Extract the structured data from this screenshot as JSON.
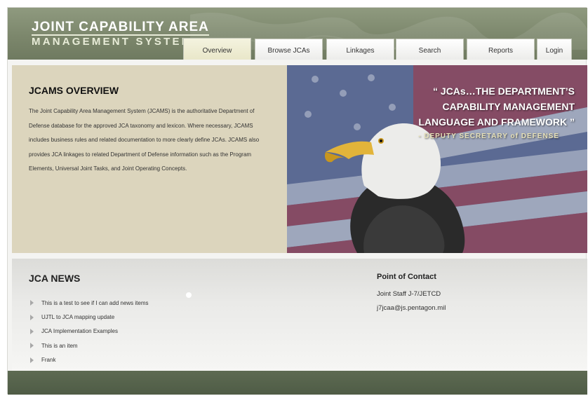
{
  "header": {
    "logo_line1": "JOINT CAPABILITY AREA",
    "logo_line2": "MANAGEMENT SYSTEM"
  },
  "tabs": [
    {
      "label": "Overview",
      "active": true
    },
    {
      "label": "Browse JCAs",
      "active": false
    },
    {
      "label": "Linkages",
      "active": false
    },
    {
      "label": "Search",
      "active": false
    },
    {
      "label": "Reports",
      "active": false
    },
    {
      "label": "Login",
      "active": false
    }
  ],
  "overview": {
    "title": "JCAMS OVERVIEW",
    "body": "The Joint Capability Area Management System (JCAMS) is the authoritative Department of Defense database for the approved JCA taxonomy and lexicon. Where necessary, JCAMS includes business rules and related documentation to more clearly define JCAs. JCAMS also provides JCA linkages to related Department of Defense information such as the Program Elements, Universal Joint Tasks, and Joint Operating Concepts."
  },
  "hero": {
    "quote_line1": "“ JCAs…THE DEPARTMENT’S",
    "quote_line2": "CAPABILITY MANAGEMENT",
    "quote_line3": "LANGUAGE AND FRAMEWORK ”",
    "attribution": "- DEPUTY SECRETARY of DEFENSE"
  },
  "news": {
    "title": "JCA NEWS",
    "items": [
      "This is a test to see if I can add news items",
      "UJTL to JCA mapping update",
      "JCA Implementation Examples",
      "This is an item",
      "Frank"
    ]
  },
  "contact": {
    "title": "Point of Contact",
    "org": "Joint Staff J-7/JETCD",
    "email": "j7jcaa@js.pentagon.mil"
  },
  "colors": {
    "header": "#7c876c",
    "overview_bg": "#dcd5bd",
    "footer": "#55624b"
  }
}
